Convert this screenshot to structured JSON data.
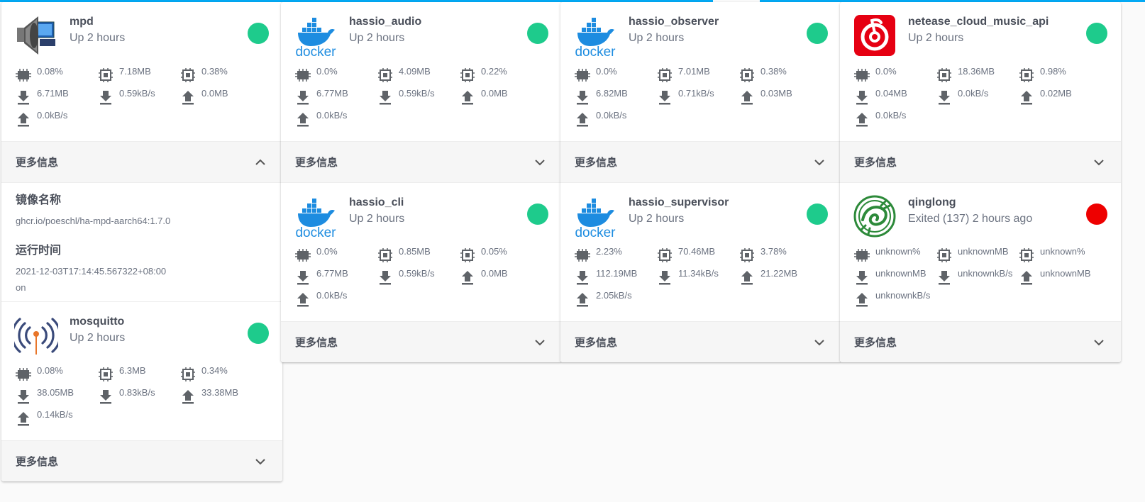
{
  "colors": {
    "running": "#1ecb8c",
    "exited": "#ee0000",
    "accent": "#03a9f4"
  },
  "more_info_label": "更多信息",
  "cards": [
    {
      "name": "mpd",
      "status": "Up 2 hours",
      "state": "running",
      "logo": "speaker-logo-icon",
      "expanded": true,
      "stats": [
        "0.08%",
        "7.18MB",
        "0.38%",
        "6.71MB",
        "0.59kB/s",
        "0.0MB",
        "0.0kB/s"
      ],
      "details": {
        "image_label": "镜像名称",
        "image_value": "ghcr.io/poeschl/ha-mpd-aarch64:1.7.0",
        "runtime_label": "运行时间",
        "runtime_value": "2021-12-03T17:14:45.567322+08:00",
        "extra_value": "on"
      }
    },
    {
      "name": "mosquitto",
      "status": "Up 2 hours",
      "state": "running",
      "logo": "broadcast-antenna-icon",
      "expanded": false,
      "stats": [
        "0.08%",
        "6.3MB",
        "0.34%",
        "38.05MB",
        "0.83kB/s",
        "33.38MB",
        "0.14kB/s"
      ]
    },
    {
      "name": "hassio_audio",
      "status": "Up 2 hours",
      "state": "running",
      "logo": "docker-logo-icon",
      "logo_text": "docker",
      "expanded": false,
      "stats": [
        "0.0%",
        "4.09MB",
        "0.22%",
        "6.77MB",
        "0.59kB/s",
        "0.0MB",
        "0.0kB/s"
      ]
    },
    {
      "name": "hassio_cli",
      "status": "Up 2 hours",
      "state": "running",
      "logo": "docker-logo-icon",
      "logo_text": "docker",
      "expanded": false,
      "stats": [
        "0.0%",
        "0.85MB",
        "0.05%",
        "6.77MB",
        "0.59kB/s",
        "0.0MB",
        "0.0kB/s"
      ]
    },
    {
      "name": "hassio_observer",
      "status": "Up 2 hours",
      "state": "running",
      "logo": "docker-logo-icon",
      "logo_text": "docker",
      "expanded": false,
      "stats": [
        "0.0%",
        "7.01MB",
        "0.38%",
        "6.82MB",
        "0.71kB/s",
        "0.03MB",
        "0.0kB/s"
      ]
    },
    {
      "name": "hassio_supervisor",
      "status": "Up 2 hours",
      "state": "running",
      "logo": "docker-logo-icon",
      "logo_text": "docker",
      "expanded": false,
      "stats": [
        "2.23%",
        "70.46MB",
        "3.78%",
        "112.19MB",
        "11.34kB/s",
        "21.22MB",
        "2.05kB/s"
      ]
    },
    {
      "name": "netease_cloud_music_api",
      "status": "Up 2 hours",
      "state": "running",
      "logo": "netease-music-logo-icon",
      "expanded": false,
      "stats": [
        "0.0%",
        "18.36MB",
        "0.98%",
        "0.04MB",
        "0.0kB/s",
        "0.02MB",
        "0.0kB/s"
      ]
    },
    {
      "name": "qinglong",
      "status": "Exited (137) 2 hours ago",
      "state": "exited",
      "logo": "qinglong-dragon-logo-icon",
      "expanded": false,
      "stats": [
        "unknown%",
        "unknownMB",
        "unknown%",
        "unknownMB",
        "unknownkB/s",
        "unknownMB",
        "unknownkB/s"
      ]
    }
  ]
}
